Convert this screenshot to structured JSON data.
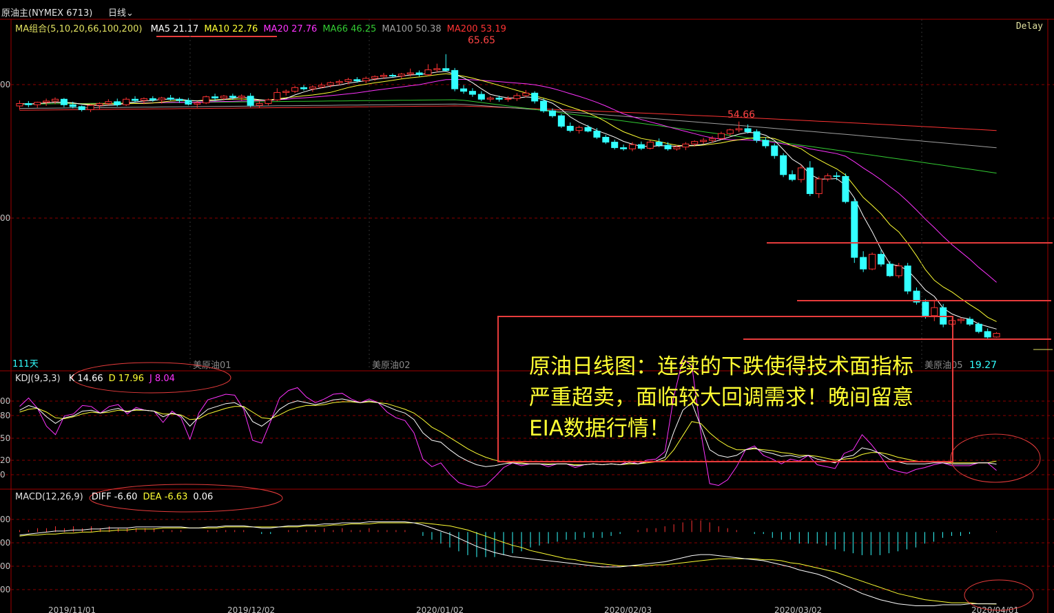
{
  "header": {
    "instrument": "原油主(NYMEX 6713)",
    "period_label": "日线",
    "delay_label": "Delay"
  },
  "ma_legend": {
    "group": "MA组合(5,10,20,66,100,200)",
    "items": [
      {
        "label": "MA5 21.17",
        "color": "#ffffff"
      },
      {
        "label": "MA10 22.76",
        "color": "#ffff33"
      },
      {
        "label": "MA20 27.76",
        "color": "#ff33ff"
      },
      {
        "label": "MA66 46.25",
        "color": "#33cc33"
      },
      {
        "label": "MA100 50.38",
        "color": "#a0a0a0"
      },
      {
        "label": "MA200 53.19",
        "color": "#ff3333"
      }
    ]
  },
  "kdj_legend": {
    "group": "KDJ(9,3,3)",
    "items": [
      {
        "label": "K 14.66",
        "color": "#ffffff"
      },
      {
        "label": "D 17.96",
        "color": "#ffff33"
      },
      {
        "label": "J 8.04",
        "color": "#ff33ff"
      }
    ]
  },
  "macd_legend": {
    "group": "MACD(12,26,9)",
    "items": [
      {
        "label": "DIFF -6.60",
        "color": "#ffffff"
      },
      {
        "label": "DEA -6.63",
        "color": "#ffff33"
      },
      {
        "label": "0.06",
        "color": "#ffffff"
      }
    ]
  },
  "price_labels": {
    "high": "65.65",
    "mid_high": "54.66",
    "last": "19.27",
    "day_count": "111天"
  },
  "contract_labels": [
    "美原油01",
    "美原油02",
    "美原油05"
  ],
  "date_labels": [
    "2019/11/01",
    "2019/12/02",
    "2020/01/02",
    "2020/02/03",
    "2020/03/02",
    "2020/04/01"
  ],
  "kdj_axis": [
    "00",
    "80",
    "50",
    "20",
    "0"
  ],
  "macd_axis": [
    "00",
    "00",
    "00",
    "00"
  ],
  "price_axis": [
    "00",
    "00"
  ],
  "annotation": {
    "lines": [
      "原油日线图：连续的下跌使得技术面指标",
      "严重超卖，面临较大回调需求！晚间留意",
      "EIA数据行情！"
    ]
  },
  "colors": {
    "up": "#ff3333",
    "down": "#33ffff",
    "grid": "#8b0000",
    "border": "#a00000"
  },
  "chart_data": {
    "type": "candlestick",
    "title": "",
    "candles": [
      [
        57.2,
        58.1,
        56.6,
        57.6
      ],
      [
        57.6,
        58.0,
        57.0,
        57.4
      ],
      [
        57.4,
        57.9,
        56.9,
        57.8
      ],
      [
        57.8,
        58.4,
        57.2,
        58.0
      ],
      [
        58.0,
        58.6,
        57.5,
        58.3
      ],
      [
        58.3,
        58.5,
        57.0,
        57.4
      ],
      [
        57.4,
        57.9,
        56.8,
        57.1
      ],
      [
        57.1,
        57.3,
        56.3,
        56.6
      ],
      [
        56.6,
        57.5,
        56.2,
        57.3
      ],
      [
        57.3,
        57.8,
        56.7,
        57.6
      ],
      [
        57.6,
        58.3,
        57.3,
        57.9
      ],
      [
        57.9,
        58.4,
        57.1,
        57.4
      ],
      [
        57.4,
        58.6,
        57.2,
        58.3
      ],
      [
        58.3,
        58.8,
        57.8,
        58.1
      ],
      [
        58.1,
        58.6,
        57.5,
        58.4
      ],
      [
        58.4,
        58.8,
        57.9,
        58.2
      ],
      [
        58.2,
        58.7,
        57.6,
        58.5
      ],
      [
        58.5,
        59.0,
        58.1,
        58.3
      ],
      [
        58.3,
        58.6,
        57.7,
        58.1
      ],
      [
        58.1,
        58.5,
        57.3,
        57.5
      ],
      [
        57.5,
        58.0,
        56.9,
        57.7
      ],
      [
        57.7,
        58.9,
        57.5,
        58.7
      ],
      [
        58.7,
        59.2,
        58.0,
        58.5
      ],
      [
        58.5,
        59.0,
        58.1,
        58.8
      ],
      [
        58.8,
        59.2,
        58.2,
        58.6
      ],
      [
        58.6,
        59.1,
        58.1,
        58.8
      ],
      [
        58.8,
        59.3,
        57.0,
        57.3
      ],
      [
        57.3,
        58.0,
        56.9,
        57.6
      ],
      [
        57.6,
        58.4,
        57.3,
        58.2
      ],
      [
        58.2,
        60.1,
        58.0,
        59.4
      ],
      [
        59.4,
        59.9,
        58.9,
        59.6
      ],
      [
        59.6,
        60.5,
        59.3,
        60.2
      ],
      [
        60.2,
        60.6,
        59.7,
        60.0
      ],
      [
        60.0,
        60.6,
        59.5,
        60.3
      ],
      [
        60.3,
        61.0,
        60.1,
        60.6
      ],
      [
        60.6,
        61.2,
        60.2,
        61.0
      ],
      [
        61.0,
        61.5,
        60.6,
        61.2
      ],
      [
        61.2,
        61.8,
        60.8,
        61.5
      ],
      [
        61.5,
        61.9,
        61.0,
        61.3
      ],
      [
        61.3,
        62.0,
        60.9,
        61.7
      ],
      [
        61.7,
        62.2,
        61.3,
        62.0
      ],
      [
        62.0,
        62.6,
        61.6,
        62.2
      ],
      [
        62.2,
        62.5,
        61.8,
        62.1
      ],
      [
        62.1,
        62.6,
        61.7,
        62.4
      ],
      [
        62.4,
        63.3,
        62.0,
        62.6
      ],
      [
        62.6,
        63.0,
        62.0,
        62.3
      ],
      [
        62.3,
        64.0,
        62.1,
        63.1
      ],
      [
        63.1,
        64.1,
        62.7,
        63.3
      ],
      [
        63.3,
        65.65,
        62.8,
        63.0
      ],
      [
        63.0,
        63.4,
        59.6,
        60.0
      ],
      [
        60.0,
        60.6,
        59.2,
        59.6
      ],
      [
        59.6,
        60.1,
        58.7,
        59.1
      ],
      [
        59.1,
        59.6,
        58.0,
        58.3
      ],
      [
        58.3,
        58.8,
        57.9,
        58.5
      ],
      [
        58.5,
        58.9,
        57.9,
        58.3
      ],
      [
        58.3,
        58.8,
        57.9,
        58.4
      ],
      [
        58.4,
        59.3,
        58.0,
        58.9
      ],
      [
        58.9,
        59.8,
        58.6,
        59.3
      ],
      [
        59.3,
        59.6,
        57.6,
        58.0
      ],
      [
        58.0,
        58.4,
        56.1,
        56.4
      ],
      [
        56.4,
        56.8,
        55.3,
        55.6
      ],
      [
        55.6,
        55.9,
        53.6,
        53.9
      ],
      [
        53.9,
        54.5,
        52.9,
        53.2
      ],
      [
        53.2,
        54.0,
        52.7,
        53.7
      ],
      [
        53.7,
        54.1,
        52.9,
        53.1
      ],
      [
        53.1,
        53.6,
        51.8,
        52.1
      ],
      [
        52.1,
        52.5,
        51.0,
        51.3
      ],
      [
        51.3,
        51.7,
        50.1,
        50.4
      ],
      [
        50.4,
        50.9,
        49.9,
        50.2
      ],
      [
        50.2,
        51.3,
        49.8,
        50.9
      ],
      [
        50.9,
        51.4,
        50.0,
        50.3
      ],
      [
        50.3,
        51.6,
        50.1,
        51.3
      ],
      [
        51.3,
        51.9,
        50.5,
        50.8
      ],
      [
        50.8,
        51.3,
        49.9,
        50.2
      ],
      [
        50.2,
        50.8,
        49.9,
        50.5
      ],
      [
        50.5,
        51.3,
        50.0,
        51.0
      ],
      [
        51.0,
        51.6,
        50.6,
        51.4
      ],
      [
        51.4,
        52.0,
        51.0,
        51.6
      ],
      [
        51.6,
        52.3,
        51.2,
        51.9
      ],
      [
        51.9,
        53.0,
        51.7,
        52.7
      ],
      [
        52.7,
        53.5,
        52.3,
        53.3
      ],
      [
        53.3,
        54.66,
        52.9,
        53.5
      ],
      [
        53.5,
        54.2,
        52.7,
        53.0
      ],
      [
        53.0,
        53.4,
        51.2,
        51.6
      ],
      [
        51.6,
        52.1,
        50.3,
        50.7
      ],
      [
        50.7,
        51.1,
        48.6,
        49.1
      ],
      [
        49.1,
        49.5,
        45.6,
        46.0
      ],
      [
        46.0,
        46.7,
        44.9,
        45.2
      ],
      [
        45.2,
        47.6,
        44.7,
        47.1
      ],
      [
        47.1,
        48.2,
        42.5,
        42.9
      ],
      [
        42.9,
        45.7,
        42.2,
        45.3
      ],
      [
        45.3,
        46.2,
        44.9,
        45.8
      ],
      [
        45.8,
        46.4,
        45.1,
        45.7
      ],
      [
        45.7,
        46.2,
        41.3,
        41.6
      ],
      [
        41.6,
        42.1,
        31.6,
        32.5
      ],
      [
        32.5,
        33.5,
        30.1,
        30.6
      ],
      [
        30.6,
        33.3,
        30.4,
        33.0
      ],
      [
        33.0,
        33.7,
        31.0,
        31.4
      ],
      [
        31.4,
        31.9,
        29.3,
        29.5
      ],
      [
        29.5,
        31.6,
        29.1,
        31.1
      ],
      [
        31.1,
        31.6,
        26.5,
        27.0
      ],
      [
        27.0,
        27.6,
        24.8,
        25.2
      ],
      [
        25.2,
        25.7,
        22.5,
        23.0
      ],
      [
        23.0,
        25.6,
        22.1,
        24.3
      ],
      [
        24.3,
        24.9,
        21.1,
        21.6
      ],
      [
        21.6,
        22.6,
        21.2,
        22.2
      ],
      [
        22.2,
        22.7,
        21.7,
        22.4
      ],
      [
        22.4,
        22.8,
        21.3,
        21.6
      ],
      [
        21.6,
        21.9,
        20.1,
        20.4
      ],
      [
        20.4,
        20.9,
        19.27,
        19.5
      ],
      [
        19.5,
        20.3,
        19.4,
        20.1
      ]
    ],
    "kdj": {
      "K": [
        72,
        77,
        74,
        65,
        58,
        64,
        66,
        71,
        72,
        69,
        72,
        74,
        70,
        73,
        72,
        71,
        65,
        69,
        66,
        55,
        65,
        73,
        76,
        79,
        80,
        75,
        60,
        55,
        62,
        73,
        79,
        82,
        80,
        78,
        80,
        83,
        84,
        82,
        80,
        82,
        80,
        76,
        72,
        69,
        62,
        48,
        40,
        38,
        30,
        23,
        18,
        14,
        12,
        13,
        15,
        16,
        15,
        15,
        15,
        14,
        15,
        15,
        13,
        14,
        15,
        14,
        15,
        14,
        16,
        15,
        17,
        18,
        22,
        49,
        72,
        80,
        55,
        30,
        24,
        22,
        24,
        30,
        32,
        28,
        26,
        23,
        24,
        22,
        24,
        20,
        18,
        16,
        22,
        24,
        32,
        30,
        26,
        20,
        17,
        15,
        15,
        15,
        16,
        16,
        15,
        15,
        15,
        16,
        16,
        14.66
      ],
      "D": [
        70,
        73,
        74,
        70,
        64,
        63,
        65,
        68,
        70,
        69,
        70,
        72,
        71,
        72,
        72,
        71,
        68,
        68,
        67,
        62,
        63,
        68,
        71,
        74,
        76,
        76,
        70,
        64,
        63,
        67,
        72,
        75,
        77,
        77,
        78,
        80,
        81,
        81,
        80,
        81,
        80,
        79,
        76,
        73,
        69,
        62,
        54,
        49,
        43,
        37,
        31,
        26,
        22,
        19,
        17,
        16,
        16,
        15,
        15,
        15,
        15,
        15,
        14,
        14,
        15,
        14,
        15,
        14,
        15,
        15,
        16,
        17,
        19,
        30,
        45,
        60,
        58,
        48,
        40,
        34,
        30,
        30,
        31,
        30,
        29,
        27,
        26,
        24,
        24,
        23,
        21,
        19,
        20,
        21,
        25,
        27,
        27,
        25,
        22,
        20,
        18,
        17,
        17,
        17,
        16,
        16,
        16,
        16,
        16,
        17.96
      ],
      "J": [
        76,
        85,
        74,
        55,
        46,
        66,
        68,
        77,
        76,
        69,
        76,
        78,
        68,
        75,
        72,
        71,
        59,
        71,
        64,
        41,
        69,
        83,
        86,
        89,
        88,
        73,
        40,
        37,
        60,
        85,
        93,
        96,
        86,
        80,
        84,
        89,
        90,
        84,
        80,
        84,
        80,
        70,
        64,
        61,
        48,
        20,
        12,
        16,
        4,
        -5,
        -8,
        -10,
        -8,
        1,
        11,
        16,
        13,
        15,
        15,
        12,
        15,
        15,
        11,
        14,
        15,
        14,
        15,
        14,
        18,
        15,
        19,
        20,
        28,
        87,
        126,
        120,
        49,
        -6,
        -8,
        -2,
        12,
        30,
        34,
        24,
        20,
        15,
        20,
        18,
        24,
        14,
        12,
        10,
        26,
        30,
        46,
        36,
        24,
        10,
        7,
        5,
        9,
        11,
        14,
        16,
        13,
        13,
        13,
        16,
        16,
        8.04
      ]
    },
    "macd": {
      "DIFF": [
        0.1,
        0.2,
        0.3,
        0.4,
        0.5,
        0.5,
        0.6,
        0.6,
        0.7,
        0.7,
        0.8,
        0.8,
        0.8,
        0.9,
        0.9,
        0.9,
        0.9,
        0.9,
        0.9,
        0.8,
        0.8,
        0.9,
        0.9,
        1.0,
        1.0,
        1.0,
        0.9,
        0.8,
        0.8,
        0.9,
        1.0,
        1.0,
        1.1,
        1.1,
        1.2,
        1.2,
        1.3,
        1.3,
        1.3,
        1.4,
        1.4,
        1.4,
        1.4,
        1.4,
        1.3,
        1.1,
        0.8,
        0.5,
        0.2,
        -0.2,
        -0.6,
        -1.0,
        -1.3,
        -1.6,
        -1.8,
        -2.0,
        -2.1,
        -2.2,
        -2.3,
        -2.4,
        -2.5,
        -2.6,
        -2.7,
        -2.8,
        -2.9,
        -3.0,
        -3.0,
        -3.0,
        -2.9,
        -2.8,
        -2.7,
        -2.6,
        -2.5,
        -2.3,
        -2.1,
        -1.9,
        -1.8,
        -1.8,
        -1.9,
        -2.0,
        -2.1,
        -2.2,
        -2.3,
        -2.4,
        -2.6,
        -2.8,
        -3.0,
        -3.3,
        -3.5,
        -3.7,
        -4.0,
        -4.4,
        -4.8,
        -5.2,
        -5.6,
        -5.9,
        -6.2,
        -6.4,
        -6.6,
        -6.7,
        -6.8,
        -6.8,
        -6.8,
        -6.7,
        -6.7,
        -6.7,
        -6.6,
        -6.6,
        -6.6,
        -6.6
      ],
      "DEA": [
        0.0,
        0.1,
        0.1,
        0.2,
        0.2,
        0.3,
        0.3,
        0.4,
        0.4,
        0.5,
        0.5,
        0.6,
        0.6,
        0.7,
        0.7,
        0.7,
        0.8,
        0.8,
        0.8,
        0.8,
        0.8,
        0.8,
        0.8,
        0.9,
        0.9,
        0.9,
        0.9,
        0.9,
        0.9,
        0.9,
        0.9,
        0.9,
        1.0,
        1.0,
        1.0,
        1.1,
        1.1,
        1.2,
        1.2,
        1.2,
        1.3,
        1.3,
        1.3,
        1.3,
        1.3,
        1.3,
        1.2,
        1.1,
        1.0,
        0.8,
        0.6,
        0.3,
        0.0,
        -0.3,
        -0.6,
        -0.9,
        -1.1,
        -1.4,
        -1.6,
        -1.8,
        -2.0,
        -2.2,
        -2.3,
        -2.5,
        -2.6,
        -2.7,
        -2.8,
        -2.9,
        -2.9,
        -2.9,
        -2.9,
        -2.8,
        -2.8,
        -2.7,
        -2.6,
        -2.5,
        -2.4,
        -2.3,
        -2.2,
        -2.2,
        -2.2,
        -2.2,
        -2.2,
        -2.3,
        -2.3,
        -2.4,
        -2.6,
        -2.7,
        -2.9,
        -3.1,
        -3.3,
        -3.5,
        -3.8,
        -4.1,
        -4.4,
        -4.7,
        -5.0,
        -5.3,
        -5.6,
        -5.8,
        -6.0,
        -6.2,
        -6.3,
        -6.4,
        -6.5,
        -6.5,
        -6.5,
        -6.6,
        -6.6,
        -6.63
      ]
    }
  }
}
